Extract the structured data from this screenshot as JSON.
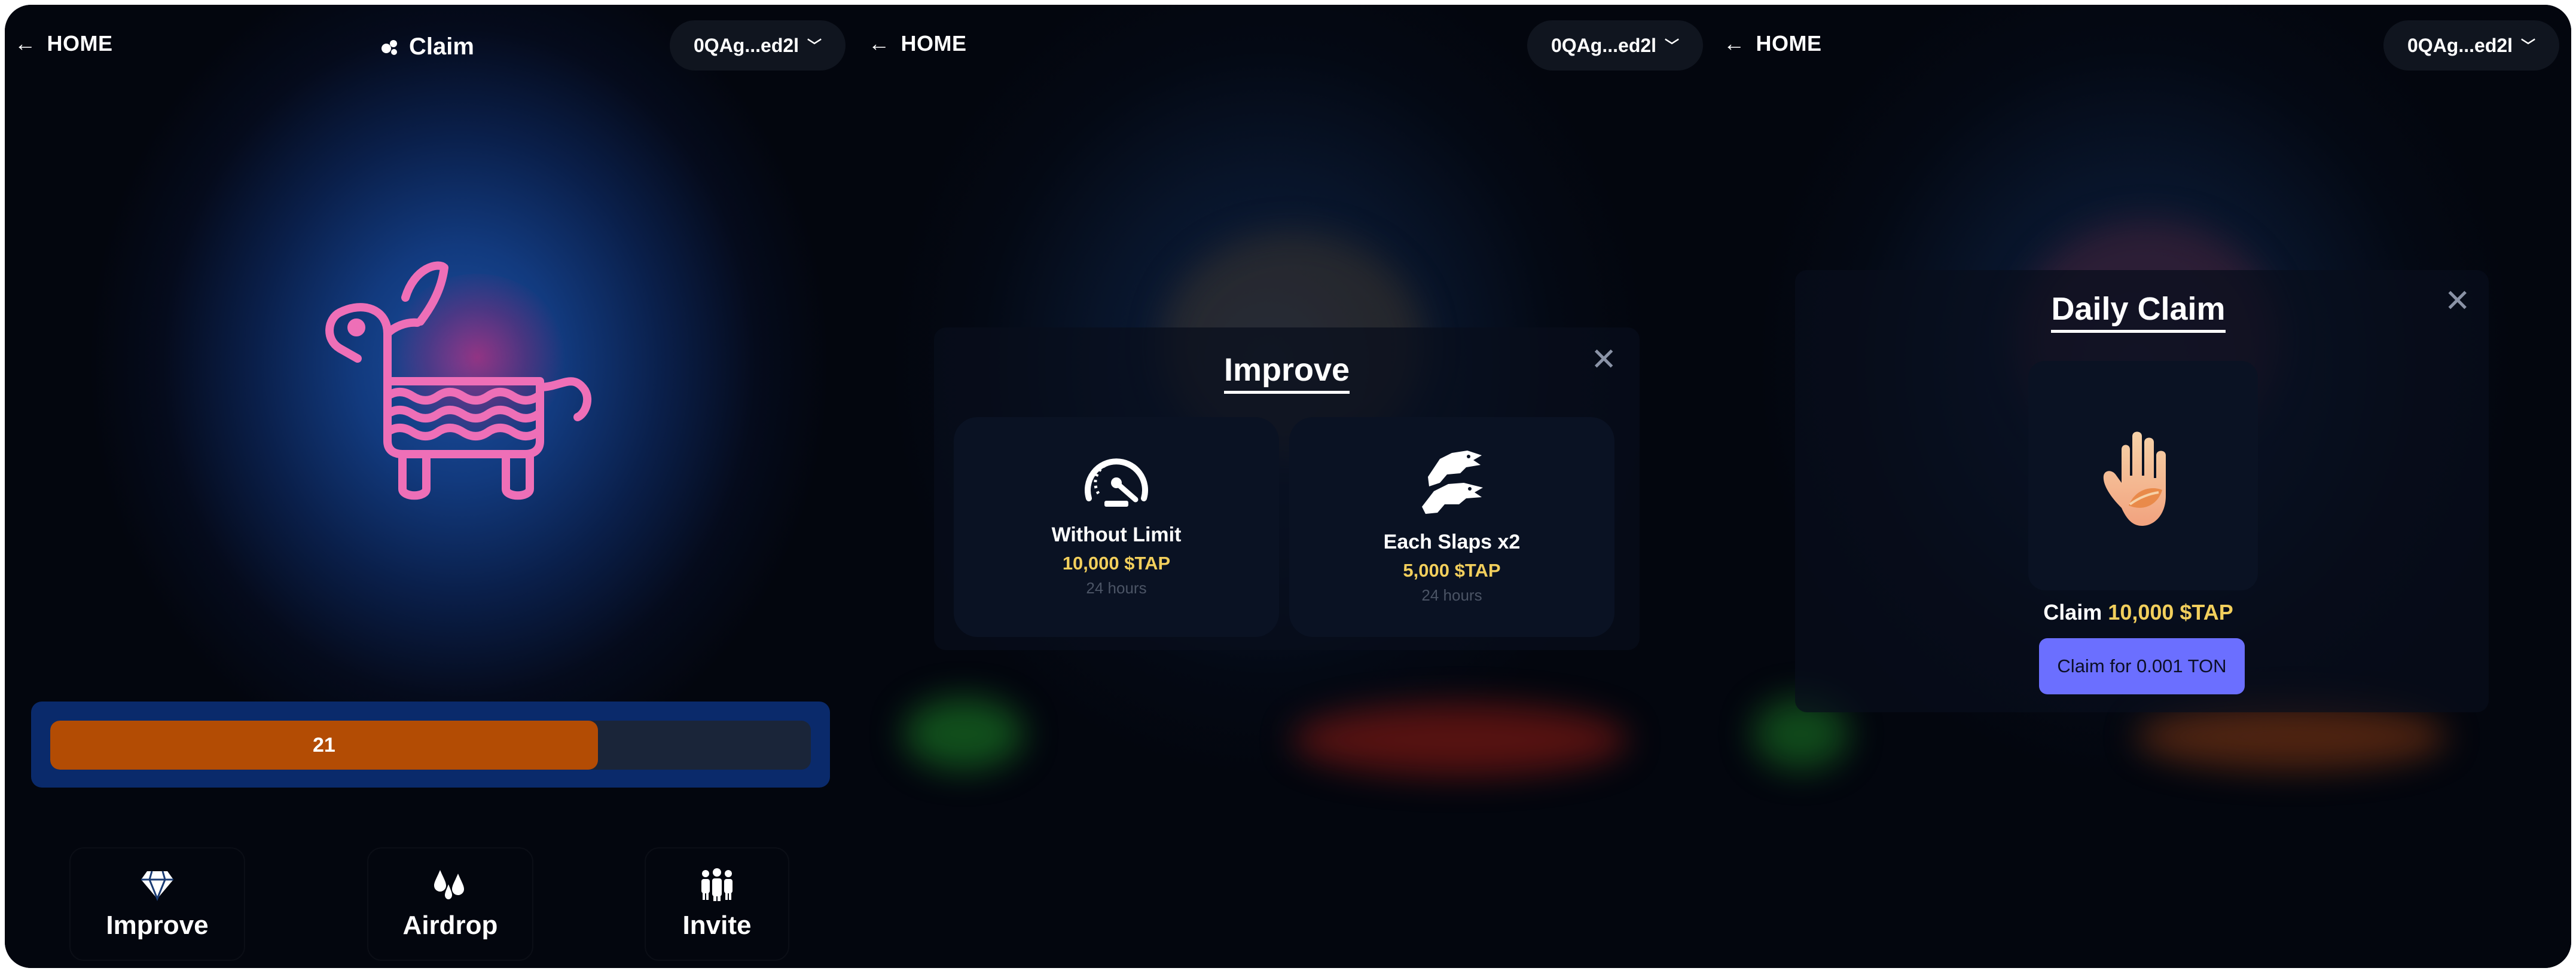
{
  "colors": {
    "progress_fill": "#b34c04",
    "accent_yellow": "#f2cf5c",
    "claim_button": "#6b6fff",
    "pinata_pink": "#ee6fb7"
  },
  "panel1": {
    "home_label": "HOME",
    "title": "Claim",
    "wallet": "0QAg...ed2l",
    "progress": {
      "value": 0.72,
      "label": "21"
    },
    "nav": [
      {
        "label": "Improve",
        "icon": "diamond-icon"
      },
      {
        "label": "Airdrop",
        "icon": "drops-icon"
      },
      {
        "label": "Invite",
        "icon": "group-icon"
      }
    ]
  },
  "panel2": {
    "home_label": "HOME",
    "wallet": "0QAg...ed2l",
    "modal": {
      "title": "Improve",
      "close": "✕",
      "cards": [
        {
          "title": "Without Limit",
          "price": "10,000 $TAP",
          "duration": "24 hours",
          "icon": "speedometer-icon"
        },
        {
          "title": "Each Slaps x2",
          "price": "5,000 $TAP",
          "duration": "24 hours",
          "icon": "dragons-icon"
        }
      ]
    }
  },
  "panel3": {
    "home_label": "HOME",
    "wallet": "0QAg...ed2l",
    "modal": {
      "title": "Daily Claim",
      "close": "✕",
      "claim_prefix": "Claim",
      "claim_amount": "10,000 $TAP",
      "button": "Claim for 0.001 TON",
      "icon": "hand-icon"
    }
  }
}
